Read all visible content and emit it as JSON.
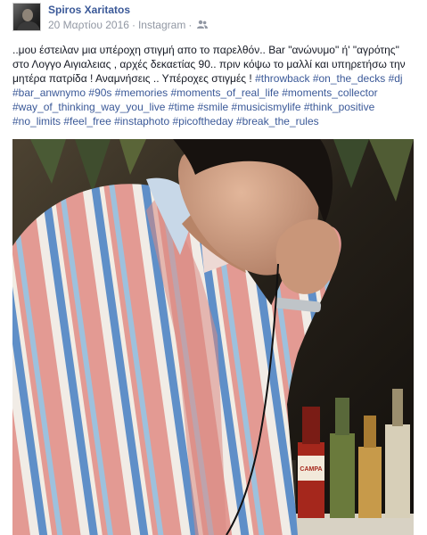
{
  "post": {
    "author": "Spiros Xaritatos",
    "date": "20 Μαρτίου 2016",
    "separator": "·",
    "source": "Instagram",
    "privacy_icon": "friends-icon",
    "caption_text": "..μου έστειλαν μια υπέροχη στιγμή απο το παρελθόν.. Bar \"ανώνυμο\" ή' \"αγρότης\" στο Λογγο Αιγιαλειας , αρχές δεκαετίας 90.. πριν κόψω το μαλλί και υπηρετήσω την μητέρα πατρίδα ! Αναμνήσεις .. Υπέροχες στιγμές ! ",
    "hashtags": [
      "#throwback",
      "#on_the_decks",
      "#dj",
      "#bar_anwnymo",
      "#90s",
      "#memories",
      "#moments_of_real_life",
      "#moments_collector",
      "#way_of_thinking_way_you_live",
      "#time",
      "#smile",
      "#musicismylife",
      "#think_positive",
      "#no_limits",
      "#feel_free",
      "#instaphoto",
      "#picoftheday",
      "#break_the_rules"
    ],
    "photo_alt": "man-with-headphones-photo",
    "bottle_label": "CAMPA"
  },
  "colors": {
    "link": "#3b5998",
    "meta": "#9197a3",
    "text": "#141823"
  }
}
